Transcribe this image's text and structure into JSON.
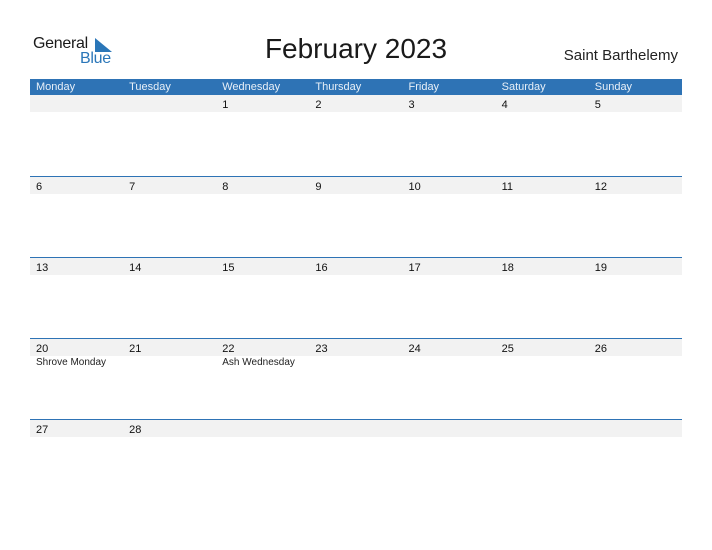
{
  "logo": {
    "line1": "General",
    "line2": "Blue"
  },
  "title": "February 2023",
  "country": "Saint Barthelemy",
  "colors": {
    "accent": "#2e73b5",
    "date_row_bg": "#f2f2f2",
    "logo_blue": "#2a76b8"
  },
  "weekdays": [
    "Monday",
    "Tuesday",
    "Wednesday",
    "Thursday",
    "Friday",
    "Saturday",
    "Sunday"
  ],
  "weeks": [
    {
      "days": [
        {
          "d": "",
          "h": ""
        },
        {
          "d": "",
          "h": ""
        },
        {
          "d": "1",
          "h": ""
        },
        {
          "d": "2",
          "h": ""
        },
        {
          "d": "3",
          "h": ""
        },
        {
          "d": "4",
          "h": ""
        },
        {
          "d": "5",
          "h": ""
        }
      ]
    },
    {
      "days": [
        {
          "d": "6",
          "h": ""
        },
        {
          "d": "7",
          "h": ""
        },
        {
          "d": "8",
          "h": ""
        },
        {
          "d": "9",
          "h": ""
        },
        {
          "d": "10",
          "h": ""
        },
        {
          "d": "11",
          "h": ""
        },
        {
          "d": "12",
          "h": ""
        }
      ]
    },
    {
      "days": [
        {
          "d": "13",
          "h": ""
        },
        {
          "d": "14",
          "h": ""
        },
        {
          "d": "15",
          "h": ""
        },
        {
          "d": "16",
          "h": ""
        },
        {
          "d": "17",
          "h": ""
        },
        {
          "d": "18",
          "h": ""
        },
        {
          "d": "19",
          "h": ""
        }
      ]
    },
    {
      "days": [
        {
          "d": "20",
          "h": "Shrove Monday"
        },
        {
          "d": "21",
          "h": ""
        },
        {
          "d": "22",
          "h": "Ash Wednesday"
        },
        {
          "d": "23",
          "h": ""
        },
        {
          "d": "24",
          "h": ""
        },
        {
          "d": "25",
          "h": ""
        },
        {
          "d": "26",
          "h": ""
        }
      ]
    },
    {
      "days": [
        {
          "d": "27",
          "h": ""
        },
        {
          "d": "28",
          "h": ""
        },
        {
          "d": "",
          "h": ""
        },
        {
          "d": "",
          "h": ""
        },
        {
          "d": "",
          "h": ""
        },
        {
          "d": "",
          "h": ""
        },
        {
          "d": "",
          "h": ""
        }
      ]
    }
  ]
}
